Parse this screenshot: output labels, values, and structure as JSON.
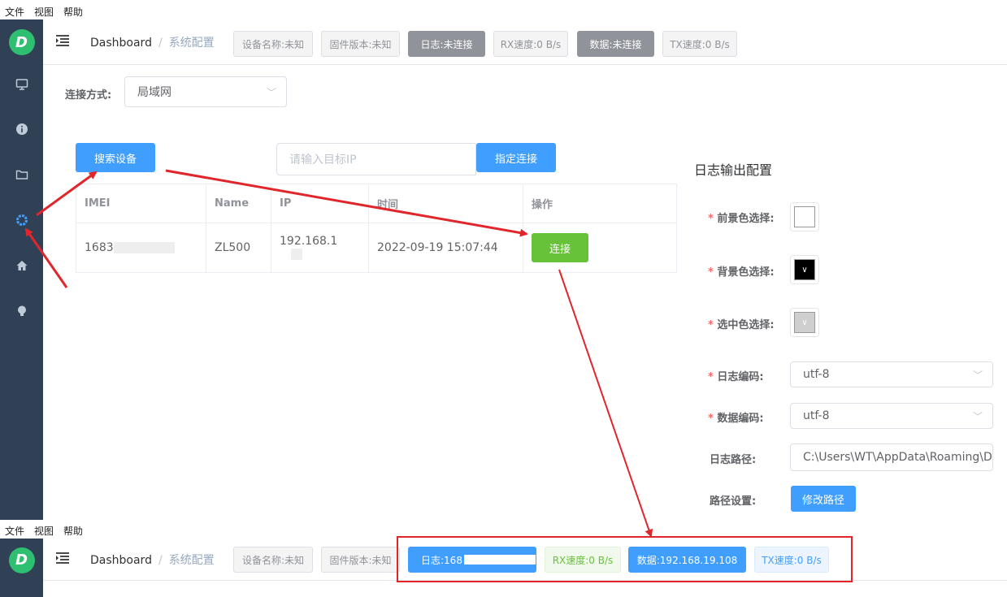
{
  "menu": [
    "文件",
    "视图",
    "帮助"
  ],
  "logo_letter": "D",
  "sidebar_icons": [
    "monitor-icon",
    "info-icon",
    "folder-icon",
    "gear-icon",
    "home-icon",
    "bulb-icon"
  ],
  "header": {
    "breadcrumb_home": "Dashboard",
    "breadcrumb_sep": "/",
    "breadcrumb_current": "系统配置",
    "device_name": "设备名称:未知",
    "firmware": "固件版本:未知",
    "log_status": "日志:未连接",
    "rx_speed": "RX速度:0 B/s",
    "data_status": "数据:未连接",
    "tx_speed": "TX速度:0 B/s"
  },
  "connection": {
    "label": "连接方式:",
    "mode": "局域网"
  },
  "search_button": "搜索设备",
  "target_ip_placeholder": "请输入目标IP",
  "connect_target_button": "指定连接",
  "table": {
    "headers": [
      "IMEI",
      "Name",
      "IP",
      "时间",
      "操作"
    ],
    "rows": [
      {
        "imei": "1683",
        "name": "ZL500",
        "ip": "192.168.1",
        "time": "2022-09-19 15:07:44",
        "action": "连接"
      }
    ]
  },
  "log_config": {
    "title": "日志输出配置",
    "fg_label": "前景色选择:",
    "bg_label": "背景色选择:",
    "sel_label": "选中色选择:",
    "log_encoding_label": "日志编码:",
    "log_encoding": "utf-8",
    "data_encoding_label": "数据编码:",
    "data_encoding": "utf-8",
    "log_path_label": "日志路径:",
    "log_path": "C:\\Users\\WT\\AppData\\Roaming\\De",
    "path_setting_label": "路径设置:",
    "modify_path_button": "修改路径"
  },
  "bottom_header": {
    "breadcrumb_home": "Dashboard",
    "breadcrumb_sep": "/",
    "breadcrumb_current": "系统配置",
    "device_name": "设备名称:未知",
    "firmware": "固件版本:未知",
    "log_status": "日志:168",
    "rx_speed": "RX速度:0 B/s",
    "data_status": "数据:192.168.19.108",
    "tx_speed": "TX速度:0 B/s"
  },
  "colors": {
    "sidebar": "#304156",
    "primary": "#409eff",
    "success": "#67c23a",
    "annotation": "#e0262b"
  }
}
